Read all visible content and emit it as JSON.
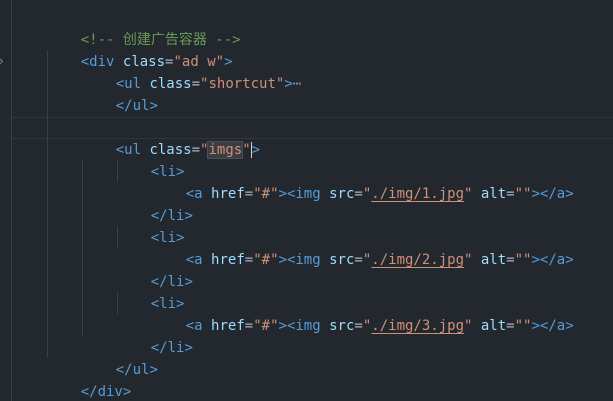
{
  "code": {
    "comment_open": "<!--",
    "comment_text": " 创建广告容器 ",
    "comment_close": "-->",
    "open_bracket": "<",
    "close_bracket": ">",
    "end_open_bracket": "</",
    "equals": "=",
    "tag_div": "div",
    "tag_ul": "ul",
    "tag_li": "li",
    "tag_a": "a",
    "tag_img": "img",
    "attr_class": "class",
    "attr_href": "href",
    "attr_src": "src",
    "attr_alt": "alt",
    "quote": "\"",
    "class_ad_w": "ad w",
    "class_shortcut": "shortcut",
    "class_imgs": "imgs",
    "href_value": "#",
    "empty_alt": "",
    "folded_marker": "⋯",
    "fold_toggle": "›",
    "img_paths": [
      "./img/1.jpg",
      "./img/2.jpg",
      "./img/3.jpg"
    ]
  }
}
